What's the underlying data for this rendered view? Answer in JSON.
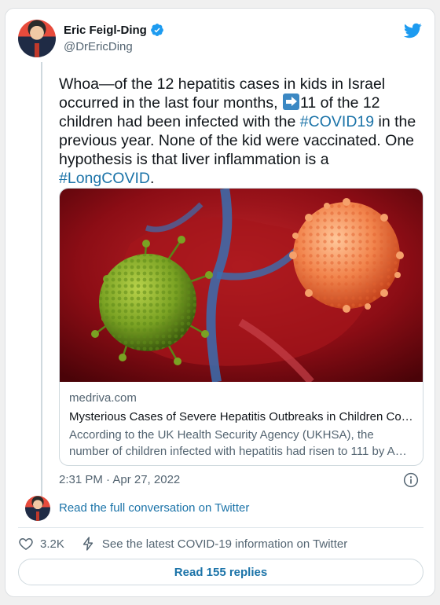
{
  "author": {
    "name": "Eric Feigl-Ding",
    "handle": "@DrEricDing"
  },
  "tweet": {
    "parts": [
      {
        "t": "Whoa—of the 12 hepatitis cases in kids in Israel occurred in the last four months, "
      },
      {
        "t": "11 of the 12 children had been infected with the "
      },
      {
        "t": "#COVID19",
        "link": true
      },
      {
        "t": " in the previous year. None of the kid were vaccinated. One hypothesis is that liver inflammation is a "
      },
      {
        "t": "#LongCOVID",
        "link": true
      },
      {
        "t": "."
      }
    ]
  },
  "preview": {
    "domain": "medriva.com",
    "title": "Mysterious Cases of Severe Hepatitis Outbreaks in Children Co…",
    "description": "According to the UK Health Security Agency (UKHSA), the number of children infected with hepatitis had risen to 111 by A…"
  },
  "timestamp": "2:31 PM · Apr 27, 2022",
  "conversation_link": "Read the full conversation on Twitter",
  "actions": {
    "likes": "3.2K",
    "covid_info": "See the latest COVID-19 information on Twitter"
  },
  "replies_button": "Read 155 replies",
  "colors": {
    "link": "#1b73a8",
    "twitter_blue": "#1d9bf0",
    "text": "#0f1419",
    "muted": "#536471"
  }
}
